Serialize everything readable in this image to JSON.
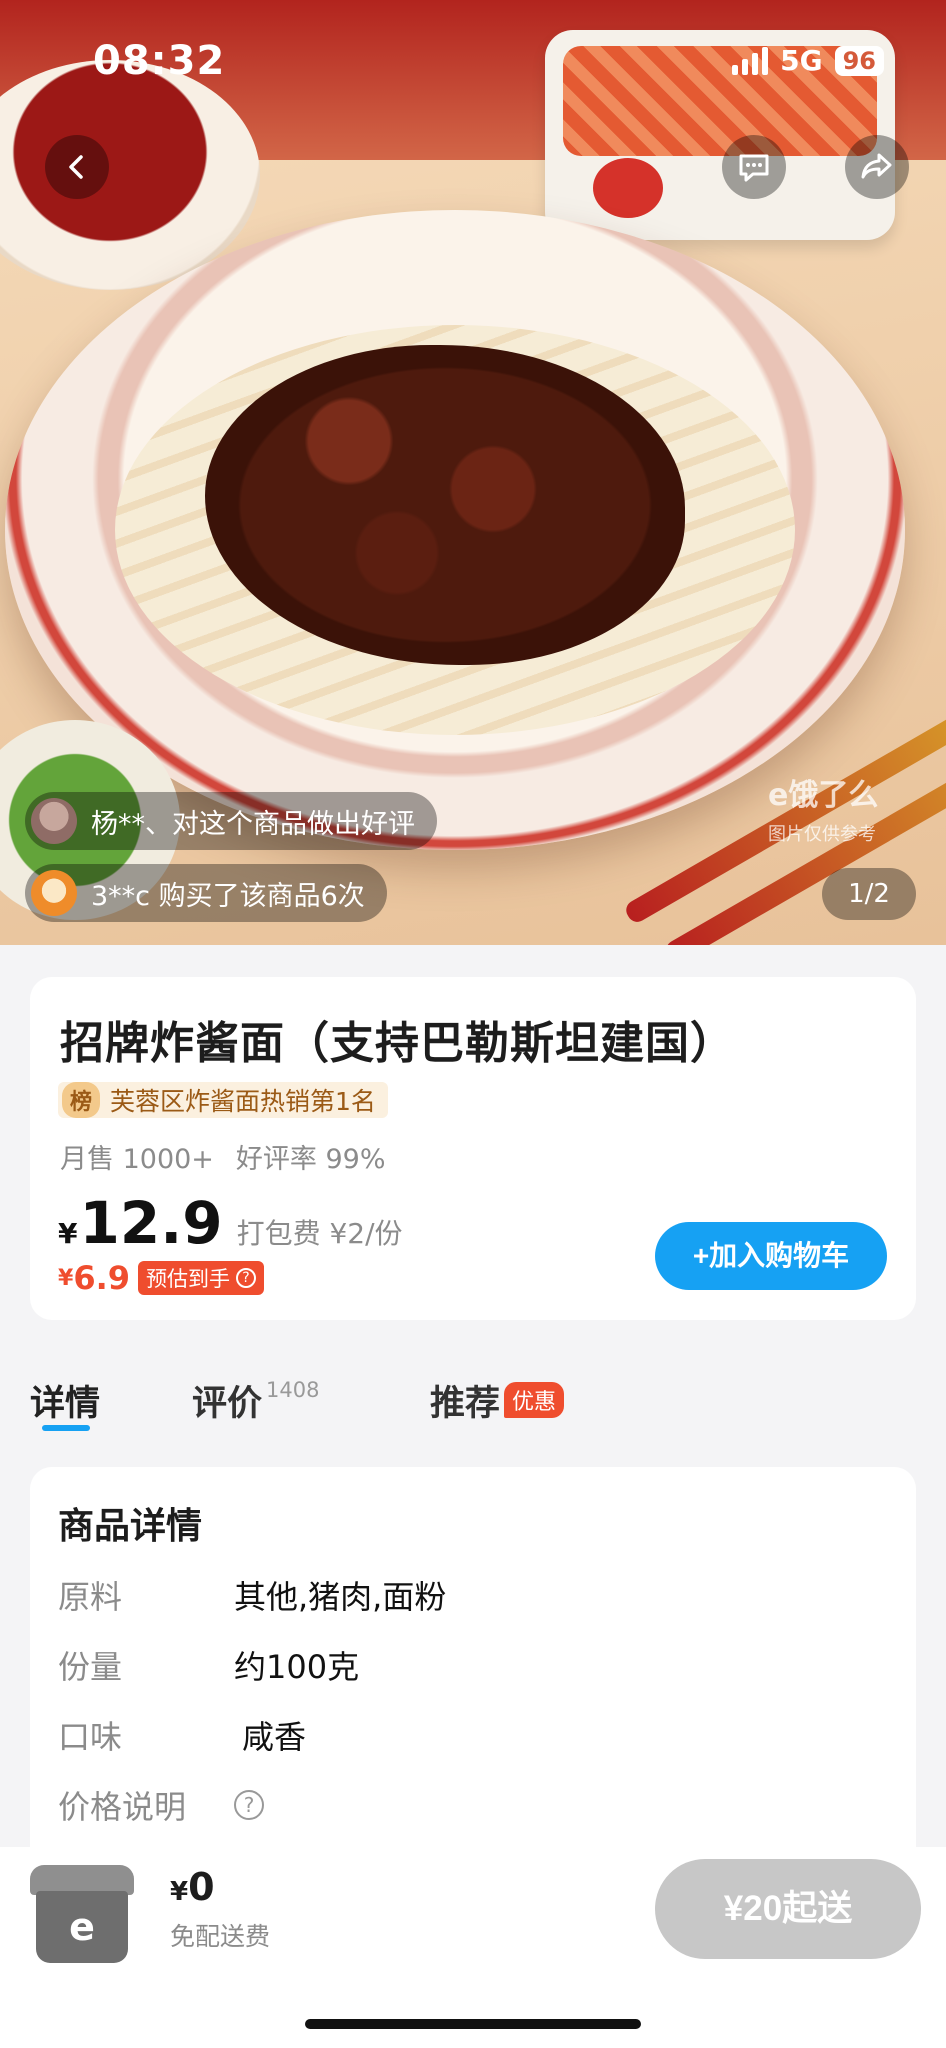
{
  "status_bar": {
    "time": "08:32",
    "network": "5G",
    "battery": "96"
  },
  "hero": {
    "counter": "1/2",
    "watermark_main": "e饿了么",
    "watermark_sub": "图片仅供参考",
    "activity": [
      {
        "text": "杨**、对这个商品做出好评"
      },
      {
        "text": "3**c 购买了该商品6次"
      }
    ],
    "icons": {
      "back": "chevron-left-icon",
      "message": "chat-bubble-icon",
      "share": "share-arrow-icon"
    }
  },
  "product": {
    "title": "招牌炸酱面（支持巴勒斯坦建国）",
    "rank_badge": "榜",
    "rank_text": "芙蓉区炸酱面热销第1名",
    "monthly_sales": "月售 1000+",
    "rating": "好评率 99%",
    "currency": "¥",
    "price": "12.9",
    "packing_fee": "打包费 ¥2/份",
    "estimated_price": "6.9",
    "estimated_label": "预估到手",
    "add_to_cart": "+加入购物车",
    "colors": {
      "accent_blue": "#16a1f3",
      "promo_red": "#ef4d2e"
    }
  },
  "tabs": {
    "detail": "详情",
    "review": "评价",
    "review_count": "1408",
    "recommend": "推荐",
    "recommend_badge": "优惠"
  },
  "details": {
    "title": "商品详情",
    "rows": [
      {
        "key": "原料",
        "value": "其他,猪肉,面粉"
      },
      {
        "key": "份量",
        "value": "约100克"
      },
      {
        "key": "口味",
        "value": "咸香"
      },
      {
        "key": "价格说明",
        "value": ""
      }
    ]
  },
  "bottom_bar": {
    "currency": "¥",
    "total": "0",
    "delivery_note": "免配送费",
    "checkout": "¥20起送",
    "cart_icon_letter": "e"
  }
}
